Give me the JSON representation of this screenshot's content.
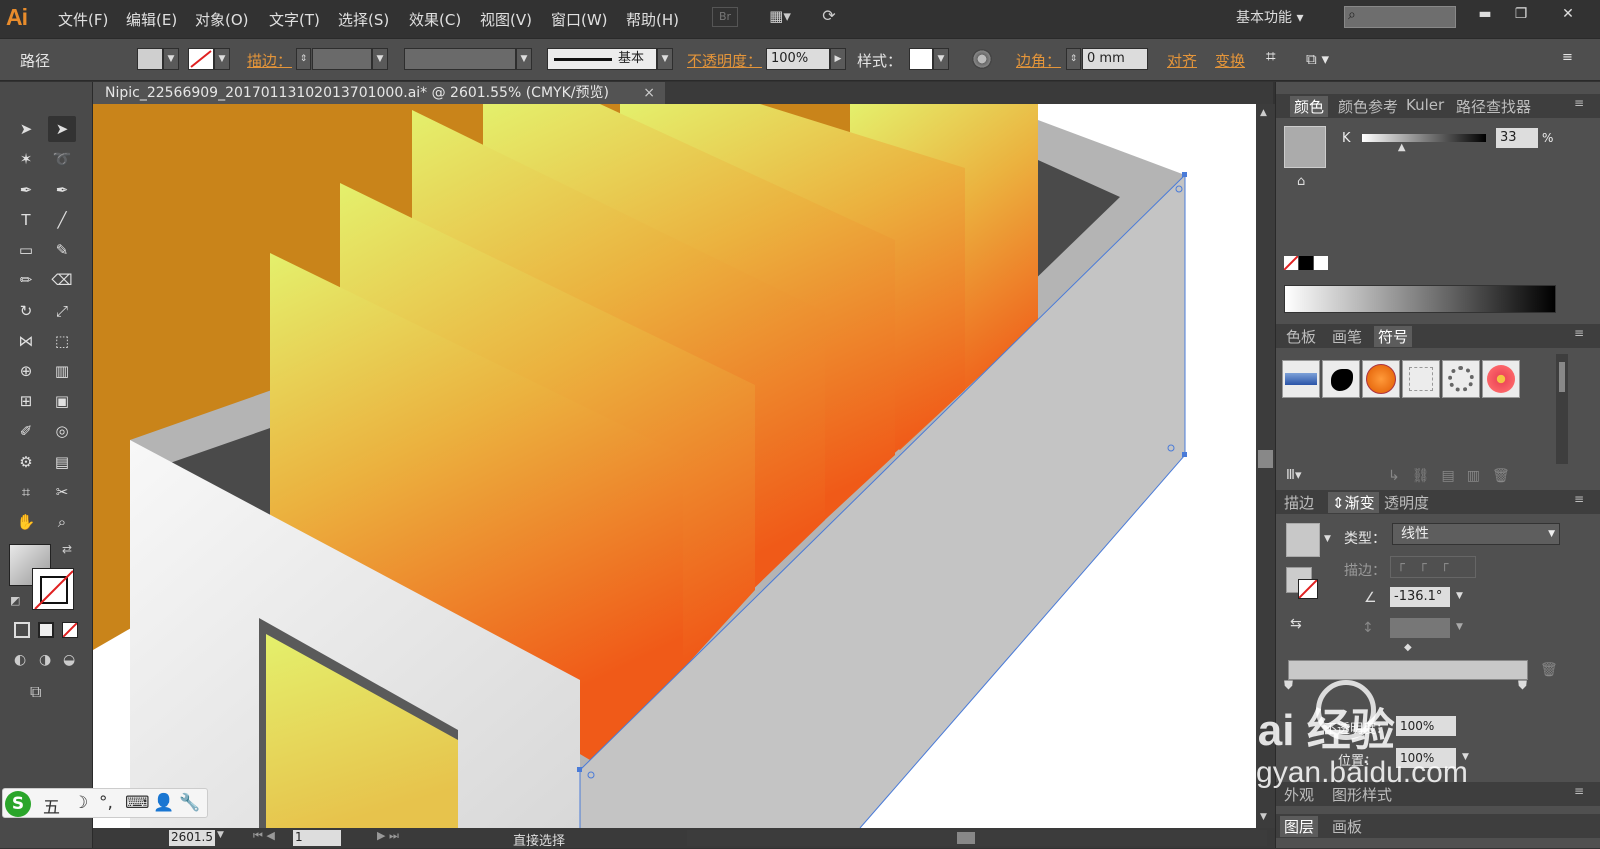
{
  "app": {
    "logo": "Ai"
  },
  "menu": {
    "items": [
      "文件(F)",
      "编辑(E)",
      "对象(O)",
      "文字(T)",
      "选择(S)",
      "效果(C)",
      "视图(V)",
      "窗口(W)",
      "帮助(H)"
    ],
    "br_label": "Br",
    "workspace": "基本功能",
    "search_placeholder": ""
  },
  "window_controls": {
    "minimize": "▬",
    "restore": "❐",
    "close": "✕"
  },
  "control_bar": {
    "object_type": "路径",
    "stroke_label": "描边：",
    "stroke_profile": "基本",
    "opacity_label": "不透明度：",
    "opacity_value": "100%",
    "style_label": "样式：",
    "corner_label": "边角：",
    "corner_value": "0 mm",
    "align_label": "对齐",
    "transform_label": "变换"
  },
  "document_tab": {
    "title": "Nipic_22566909_20170113102013701000.ai* @ 2601.55% (CMYK/预览)",
    "close": "×"
  },
  "color_panel": {
    "tabs": [
      "颜色",
      "颜色参考",
      "Kuler",
      "路径查找器"
    ],
    "channel": "K",
    "value": "33",
    "unit": "%",
    "k_fraction": 0.33
  },
  "symbols_panel": {
    "tabs": [
      "色板",
      "画笔",
      "符号"
    ]
  },
  "gradient_panel": {
    "tabs": [
      "描边",
      "渐变",
      "透明度"
    ],
    "type_label": "类型：",
    "type_value": "线性",
    "stroke_label": "描边：",
    "angle": "-136.1°",
    "opacity_label": "不透明度：",
    "opacity_value": "100%",
    "location_label": "位置：",
    "location_value": "100%"
  },
  "bottom_panels": {
    "appearance_tabs": [
      "外观",
      "图形样式"
    ],
    "layer_tabs": [
      "图层",
      "画板"
    ]
  },
  "status_bar": {
    "zoom": "2601.5",
    "page": "1",
    "tool_name": "直接选择"
  },
  "ime": {
    "items": [
      "五",
      "☽",
      "°,",
      "⌨",
      "👤",
      "🔧"
    ]
  },
  "watermark": {
    "text": "Bai 经验",
    "url": "jingyan.baidu.com"
  },
  "colors": {
    "accent": "#e4953a",
    "canvas_bg": "#c9841a",
    "selection": "#4a7bd8",
    "panel_bg": "#505050"
  }
}
